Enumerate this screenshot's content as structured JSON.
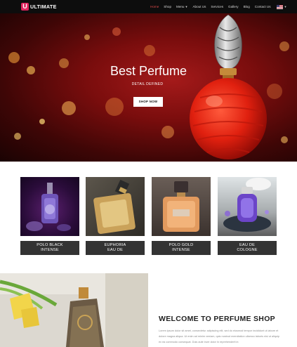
{
  "brand": {
    "logo_letter": "U",
    "name": "ULTIMATE"
  },
  "nav": {
    "items": [
      {
        "label": "Home",
        "active": true
      },
      {
        "label": "Shop"
      },
      {
        "label": "Menu",
        "dropdown": true
      },
      {
        "label": "About Us"
      },
      {
        "label": "Services"
      },
      {
        "label": "Gallery"
      },
      {
        "label": "Blog"
      },
      {
        "label": "Contact Us"
      }
    ],
    "language_icon": "us-flag-icon"
  },
  "hero": {
    "title": "Best Perfume",
    "subtitle": "DETAIL DEFINED",
    "button": "SHOP NOW"
  },
  "products": [
    {
      "line1": "POLO BLACK",
      "line2": "INTENSE"
    },
    {
      "line1": "EUPHORIA",
      "line2": "EAU DE"
    },
    {
      "line1": "POLO GOLD",
      "line2": "INTENSE"
    },
    {
      "line1": "EAU DE",
      "line2": "COLOGNE"
    }
  ],
  "welcome": {
    "title": "WELCOME TO PERFUME SHOP",
    "body": "Lorem ipsum dolor sit amet, consectetur adipiscing elit, sed do eiusmod tempor incididunt ut labore et dolore magna aliqua. Ut enim ad minim veniam, quis nostrud exercitation ullamco laboris nisi ut aliquip ex ea commodo consequat. Duis aute irure dolor in reprehenderit in"
  },
  "colors": {
    "accent": "#e0245e",
    "nav_bg": "#0d0d0d",
    "label_bg": "#333333",
    "active_link": "#e04a4a"
  }
}
